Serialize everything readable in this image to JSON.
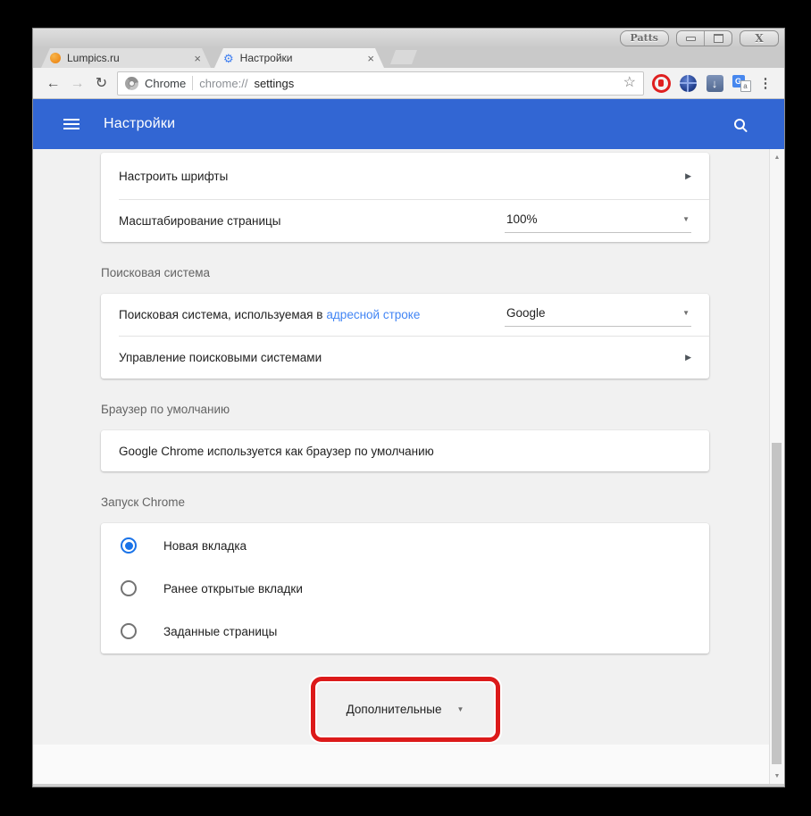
{
  "window": {
    "titlebar": {
      "app_button_label": "Patts"
    },
    "tabs": [
      {
        "label": "Lumpics.ru"
      },
      {
        "label": "Настройки"
      }
    ],
    "toolbar": {
      "site_badge_label": "Chrome",
      "url_scheme": "chrome://",
      "url_page": "settings"
    }
  },
  "header": {
    "title": "Настройки"
  },
  "settings": {
    "appearance_card": {
      "customize_fonts_label": "Настроить шрифты",
      "page_zoom_label": "Масштабирование страницы",
      "page_zoom_value": "100%"
    },
    "search_engine": {
      "heading": "Поисковая система",
      "row_text_prefix": "Поисковая система, используемая в",
      "row_text_link": "адресной строке",
      "engine_value": "Google",
      "manage_row_label": "Управление поисковыми системами"
    },
    "default_browser": {
      "heading": "Браузер по умолчанию",
      "status_text": "Google Chrome используется как браузер по умолчанию"
    },
    "startup": {
      "heading": "Запуск Chrome",
      "options": [
        {
          "label": "Новая вкладка",
          "selected": true
        },
        {
          "label": "Ранее открытые вкладки",
          "selected": false
        },
        {
          "label": "Заданные страницы",
          "selected": false
        }
      ]
    },
    "advanced_label": "Дополнительные"
  },
  "icons": {
    "back": "←",
    "forward": "→",
    "reload": "↻",
    "star": "☆",
    "menu_dots": "⋮",
    "tab_close": "×",
    "window_close": "X",
    "nav_chevron": "▶",
    "dropdown_arrow": "▼",
    "scroll_up": "▲",
    "scroll_down": "▼",
    "gear_favicon": "⚙",
    "download_arrow": "↓",
    "translate_letter": "G",
    "translate_small_letter": "a"
  },
  "colors": {
    "header_blue": "#3266d3",
    "link_blue": "#4285f4",
    "radio_selected_blue": "#1a73e8",
    "annotation_red": "#dc1a1a",
    "content_background": "#f1f1f1"
  }
}
